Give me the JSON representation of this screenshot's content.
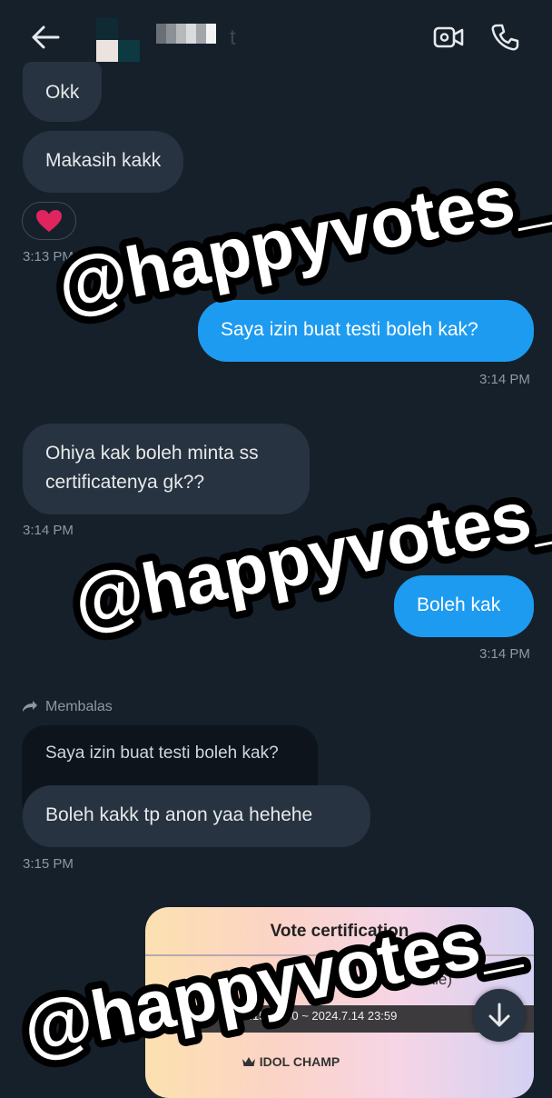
{
  "header": {
    "back_icon": "arrow-left-icon",
    "contact_name_visible": "t",
    "video_icon": "video-call-icon",
    "phone_icon": "phone-icon"
  },
  "messages": [
    {
      "side": "in",
      "text": "Okk"
    },
    {
      "side": "in",
      "text": "Makasih kakk",
      "reaction": "❤️",
      "time": "3:13 PM"
    },
    {
      "side": "out",
      "text": "Saya izin buat testi boleh kak?",
      "time": "3:14 PM"
    },
    {
      "side": "in",
      "lines": [
        "Ohiya kak boleh minta ss",
        "certificatenya gk??"
      ],
      "time": "3:14 PM"
    },
    {
      "side": "out",
      "text": "Boleh kak",
      "time": "3:14 PM"
    },
    {
      "side": "in",
      "reply_label": "Membalas",
      "quoted_text": "Saya izin buat testi boleh kak?",
      "text": "Boleh kakk tp anon yaa hehehe",
      "time": "3:15 PM"
    }
  ],
  "certificate": {
    "title": "Vote certification",
    "subtitle": "(Female)",
    "period": "2024.6.15 10:00 ~ 2024.7.14 23:59",
    "brand": "IDOL CHAMP",
    "crown_icon": "crown-icon"
  },
  "scroll_button_icon": "arrow-down-icon",
  "watermark": "@happyvotes_",
  "colors": {
    "background": "#15202b",
    "incoming_bubble": "#273340",
    "outgoing_bubble": "#1d9bf0",
    "timestamp": "#8b98a5"
  }
}
